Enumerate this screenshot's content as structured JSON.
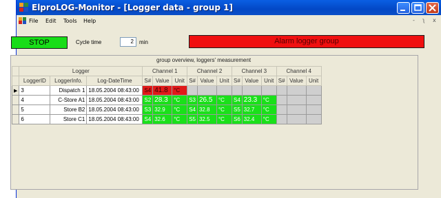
{
  "window": {
    "title": "ElproLOG-Monitor - [Logger data - group 1]"
  },
  "menu": {
    "items": [
      "File",
      "Edit",
      "Tools",
      "Help"
    ],
    "mdi_controls": [
      "-",
      "ʅ",
      "x"
    ]
  },
  "toolbar": {
    "stop_label": "STOP",
    "cycle_label": "Cycle time",
    "cycle_value": "2",
    "cycle_unit": "min",
    "alarm_label": "Alarm logger group"
  },
  "grid": {
    "caption": "group overview, loggers' measurement",
    "group_headers": {
      "logger": "Logger",
      "channels": [
        "Channel 1",
        "Channel 2",
        "Channel 3",
        "Channel 4"
      ]
    },
    "col_headers": {
      "logger_id": "LoggerID",
      "logger_info": "LoggerInfo.",
      "log_datetime": "Log-DateTime",
      "sensor": "S#",
      "value": "Value",
      "unit": "Unit"
    },
    "rows": [
      {
        "selected": true,
        "id": "3",
        "info": "Dispatch 1",
        "datetime": "18.05.2004 08:43:00",
        "channels": [
          {
            "s": "S4",
            "value": "41.8",
            "unit": "°C",
            "status": "red",
            "big": true
          },
          {
            "s": "",
            "value": "",
            "unit": "",
            "status": "grey"
          },
          {
            "s": "",
            "value": "",
            "unit": "",
            "status": "grey"
          },
          {
            "s": "",
            "value": "",
            "unit": "",
            "status": "grey"
          }
        ]
      },
      {
        "selected": false,
        "id": "4",
        "info": "C-Store A1",
        "datetime": "18.05.2004 08:43:00",
        "channels": [
          {
            "s": "S2",
            "value": "28.3",
            "unit": "°C",
            "status": "green",
            "big": true
          },
          {
            "s": "S3",
            "value": "26.5",
            "unit": "°C",
            "status": "green",
            "big": true
          },
          {
            "s": "S4",
            "value": "23.3",
            "unit": "°C",
            "status": "green",
            "big": true
          },
          {
            "s": "",
            "value": "",
            "unit": "",
            "status": "grey"
          }
        ]
      },
      {
        "selected": false,
        "id": "5",
        "info": "Store B2",
        "datetime": "18.05.2004 08:43:00",
        "channels": [
          {
            "s": "S3",
            "value": "32.9",
            "unit": "°C",
            "status": "green"
          },
          {
            "s": "S4",
            "value": "32.8",
            "unit": "°C",
            "status": "green"
          },
          {
            "s": "S5",
            "value": "32.7",
            "unit": "°C",
            "status": "green"
          },
          {
            "s": "",
            "value": "",
            "unit": "",
            "status": "grey"
          }
        ]
      },
      {
        "selected": false,
        "id": "6",
        "info": "Store C1",
        "datetime": "18.05.2004 08:43:00",
        "channels": [
          {
            "s": "S4",
            "value": "32.6",
            "unit": "°C",
            "status": "green"
          },
          {
            "s": "S5",
            "value": "32.5",
            "unit": "°C",
            "status": "green"
          },
          {
            "s": "S6",
            "value": "32.4",
            "unit": "°C",
            "status": "green"
          },
          {
            "s": "",
            "value": "",
            "unit": "",
            "status": "grey"
          }
        ]
      }
    ]
  },
  "colors": {
    "alarm": "#f01010",
    "ok": "#1ae01a",
    "stop": "#18dd18",
    "empty": "#cfcfcf"
  }
}
